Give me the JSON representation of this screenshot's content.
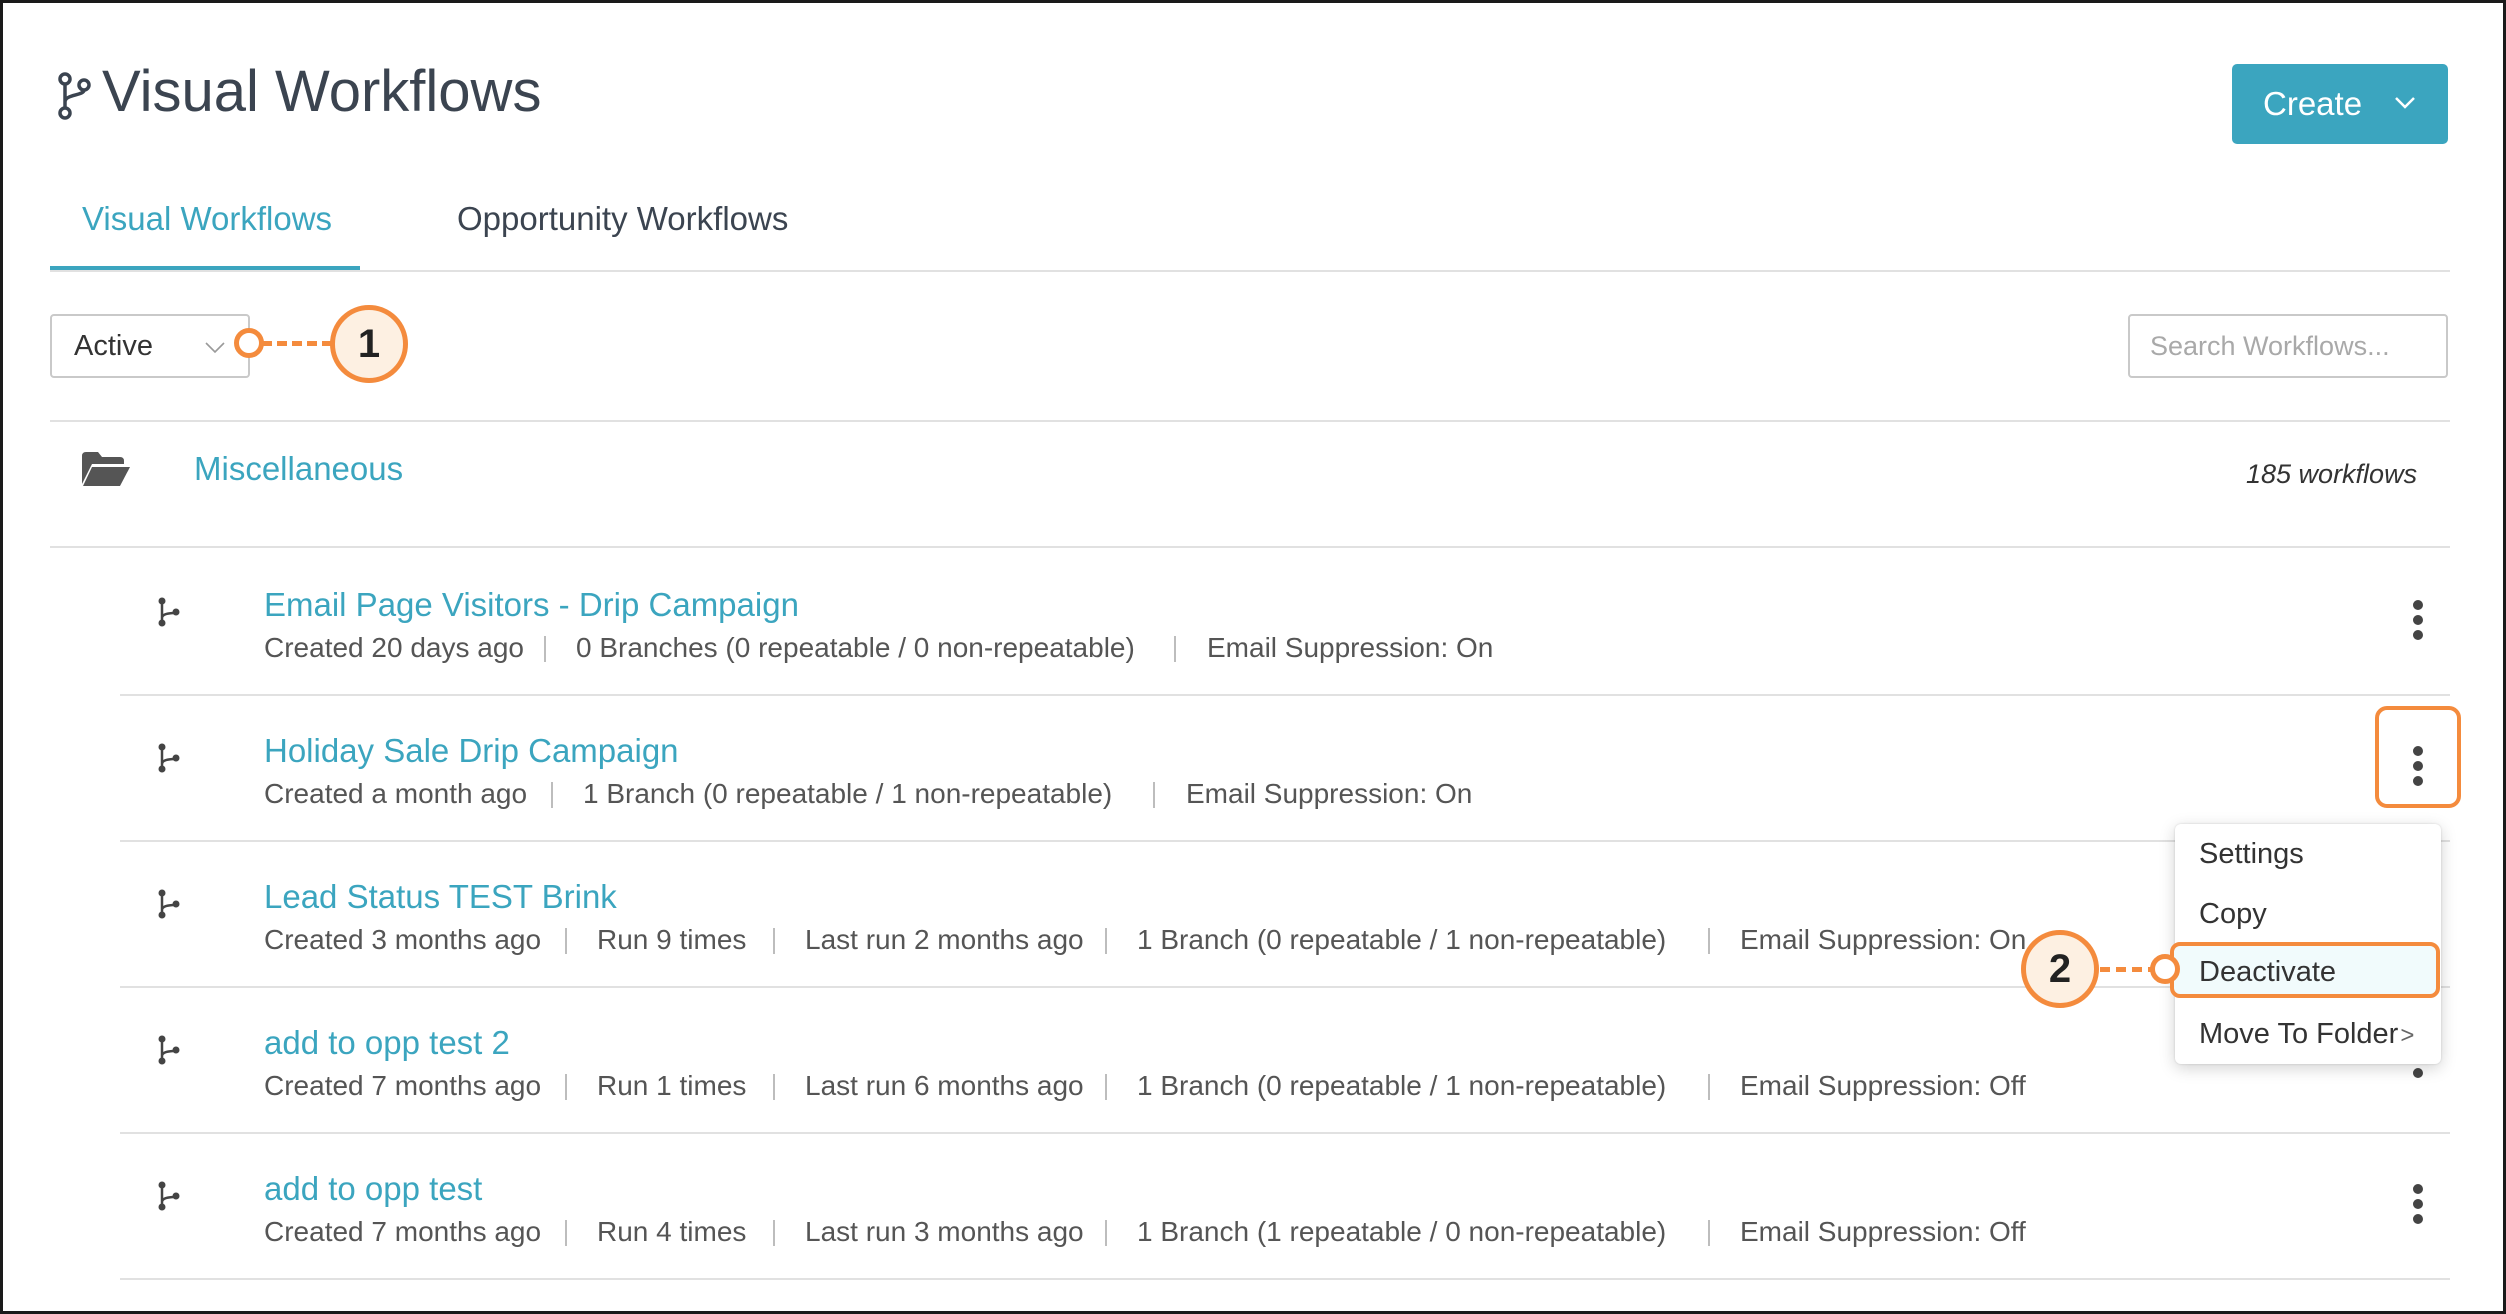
{
  "header": {
    "title": "Visual Workflows",
    "create_label": "Create"
  },
  "tabs": [
    {
      "label": "Visual Workflows",
      "active": true
    },
    {
      "label": "Opportunity Workflows",
      "active": false
    }
  ],
  "filter": {
    "selected": "Active",
    "search_placeholder": "Search Workflows..."
  },
  "folder": {
    "name": "Miscellaneous",
    "count": "185 workflows"
  },
  "workflows": [
    {
      "name": "Email Page Visitors - Drip Campaign",
      "meta": [
        "Created 20 days ago",
        "0 Branches  (0 repeatable / 0 non-repeatable)",
        "Email Suppression: On"
      ]
    },
    {
      "name": "Holiday Sale Drip Campaign",
      "meta": [
        "Created a month ago",
        "1 Branch  (0 repeatable / 1 non-repeatable)",
        "Email Suppression: On"
      ]
    },
    {
      "name": "Lead Status TEST Brink",
      "meta": [
        "Created 3 months ago",
        "Run 9 times",
        "Last run 2 months ago",
        "1 Branch  (0 repeatable / 1 non-repeatable)",
        "Email Suppression: On"
      ]
    },
    {
      "name": "add to opp test 2",
      "meta": [
        "Created 7 months ago",
        "Run 1 times",
        "Last run 6 months ago",
        "1 Branch  (0 repeatable / 1 non-repeatable)",
        "Email Suppression: Off"
      ]
    },
    {
      "name": "add to opp test",
      "meta": [
        "Created 7 months ago",
        "Run 4 times",
        "Last run 3 months ago",
        "1 Branch  (1 repeatable / 0 non-repeatable)",
        "Email Suppression: Off"
      ]
    }
  ],
  "menu": {
    "items": [
      "Settings",
      "Copy",
      "Deactivate",
      "Move To Folder"
    ],
    "submenu_indicator": ">"
  },
  "callouts": [
    "1",
    "2"
  ],
  "colors": {
    "accent": "#3ba5bf",
    "annotation": "#f48b3d",
    "title_text": "#3b4450"
  },
  "icons": {
    "title": "workflow-branch-icon",
    "folder": "open-folder-icon",
    "row": "workflow-branch-icon",
    "actions": "vertical-ellipsis-icon"
  }
}
